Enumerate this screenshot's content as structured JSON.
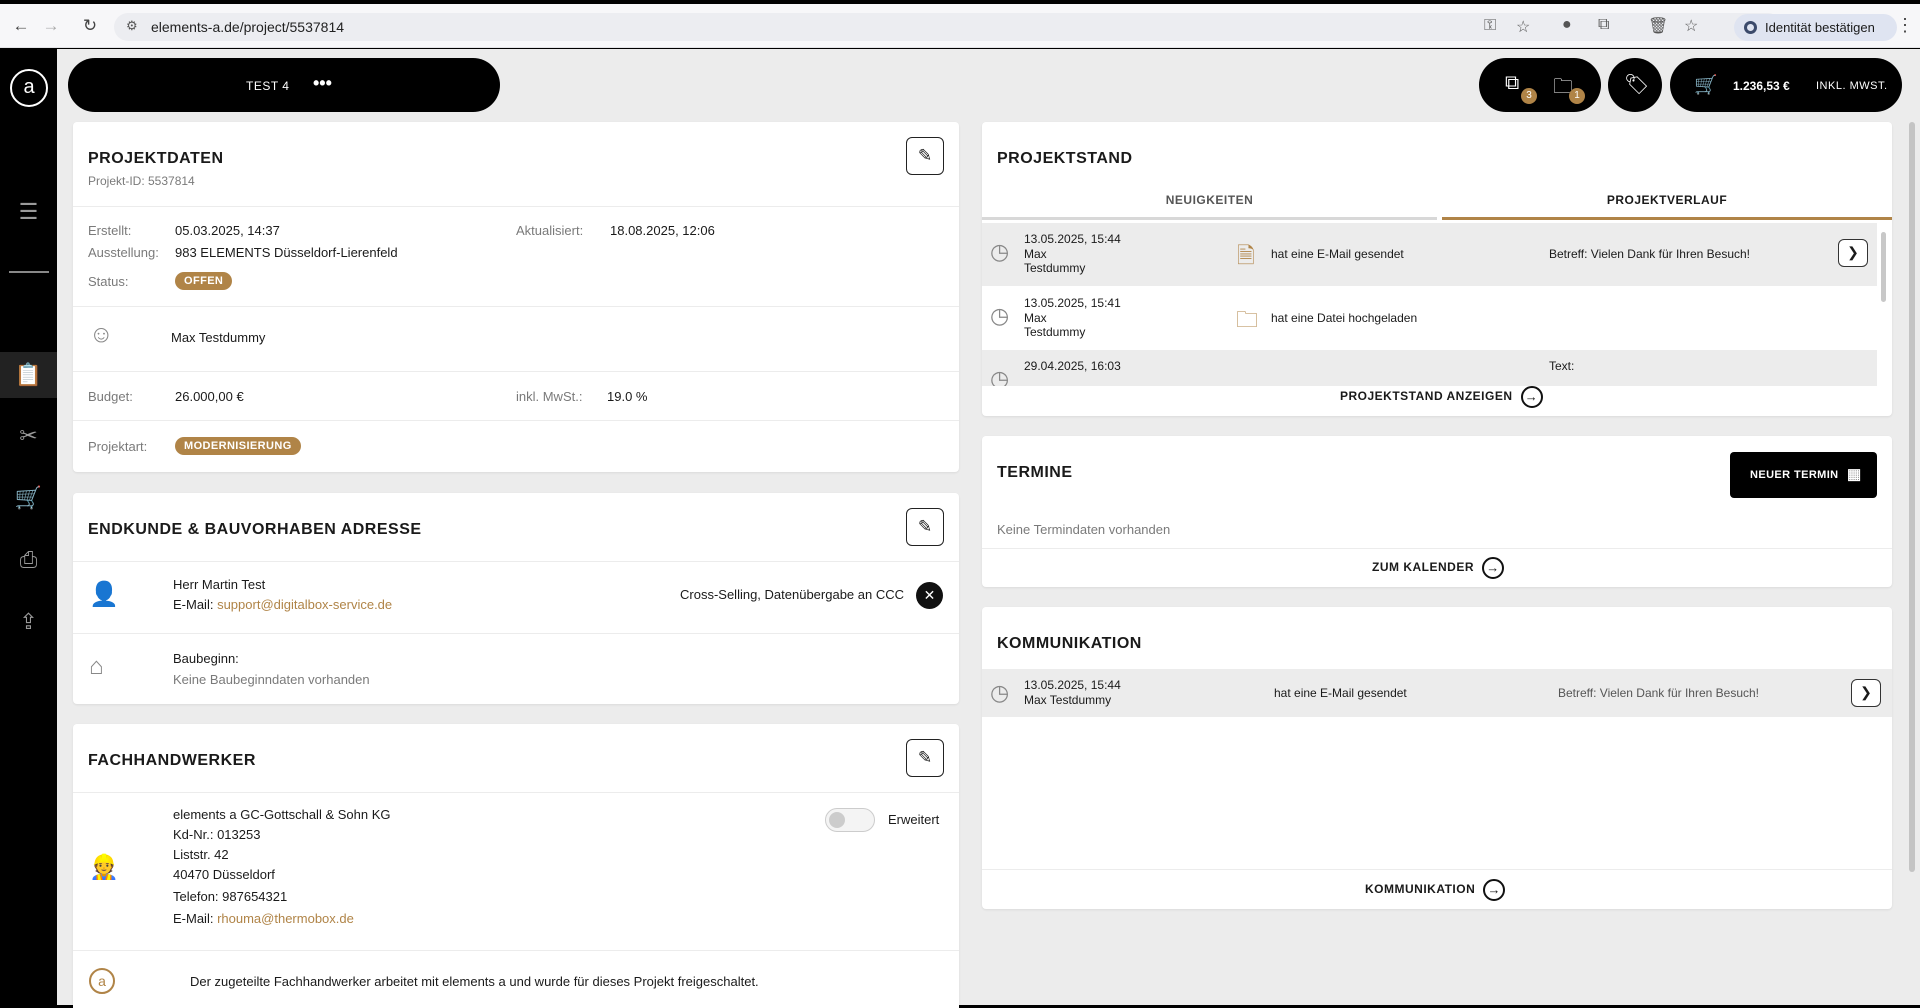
{
  "browser": {
    "url": "elements-a.de/project/5537814",
    "identity_label": "Identität bestätigen"
  },
  "header": {
    "project_name": "TEST 4",
    "more": "•••",
    "badge_left": "3",
    "badge_right": "1",
    "cart_total": "1.236,53 €",
    "cart_tax": "INKL. MWST."
  },
  "projektdaten": {
    "title": "PROJEKTDATEN",
    "project_id": "Projekt-ID: 5537814",
    "erstellt_label": "Erstellt:",
    "erstellt": "05.03.2025, 14:37",
    "aktualisiert_label": "Aktualisiert:",
    "aktualisiert": "18.08.2025, 12:06",
    "ausstellung_label": "Ausstellung:",
    "ausstellung": "983 ELEMENTS Düsseldorf-Lierenfeld",
    "status_label": "Status:",
    "status": "OFFEN",
    "contact": "Max Testdummy",
    "budget_label": "Budget:",
    "budget": "26.000,00 €",
    "mwst_label": "inkl. MwSt.:",
    "mwst": "19.0 %",
    "projektart_label": "Projektart:",
    "projektart": "MODERNISIERUNG"
  },
  "endkunde": {
    "title": "ENDKUNDE & BAUVORHABEN ADRESSE",
    "name": "Herr Martin Test",
    "email_label": "E-Mail:",
    "email": "support@digitalbox-service.de",
    "cross_selling": "Cross-Selling, Datenübergabe an CCC",
    "baubeginn_label": "Baubeginn:",
    "baubeginn": "Keine Baubeginndaten vorhanden"
  },
  "fachhandwerker": {
    "title": "FACHHANDWERKER",
    "company": "elements a GC-Gottschall & Sohn KG",
    "kdnr": "Kd-Nr.: 013253",
    "street": "Liststr. 42",
    "city": "40470 Düsseldorf",
    "phone": "Telefon: 987654321",
    "email_label": "E-Mail:",
    "email": "rhouma@thermobox.de",
    "toggle_label": "Erweitert",
    "note": "Der zugeteilte Fachhandwerker arbeitet mit elements a und wurde für dieses Projekt freigeschaltet."
  },
  "projektstand": {
    "title": "PROJEKTSTAND",
    "tabs": [
      {
        "label": "NEUIGKEITEN"
      },
      {
        "label": "PROJEKTVERLAUF"
      }
    ],
    "entries": [
      {
        "date": "13.05.2025, 15:44",
        "first": "Max",
        "last": "Testdummy",
        "action": "hat eine E-Mail gesendet",
        "detail": "Betreff: Vielen Dank für Ihren Besuch!"
      },
      {
        "date": "13.05.2025, 15:41",
        "first": "Max",
        "last": "Testdummy",
        "action": "hat eine Datei hochgeladen",
        "detail": ""
      },
      {
        "date": "29.04.2025, 16:03",
        "first": "",
        "last": "",
        "action": "",
        "detail": "Text:"
      }
    ],
    "cta": "PROJEKTSTAND ANZEIGEN"
  },
  "termine": {
    "title": "TERMINE",
    "new_button": "NEUER TERMIN",
    "empty": "Keine Termindaten vorhanden",
    "cta": "ZUM KALENDER"
  },
  "kommunikation": {
    "title": "KOMMUNIKATION",
    "entry": {
      "date": "13.05.2025, 15:44",
      "name": "Max Testdummy",
      "action": "hat eine E-Mail gesendet",
      "detail": "Betreff: Vielen Dank für Ihren Besuch!"
    },
    "cta": "KOMMUNIKATION"
  },
  "colors": {
    "accent": "#b08447",
    "dark": "#000000",
    "background": "#ececec"
  }
}
